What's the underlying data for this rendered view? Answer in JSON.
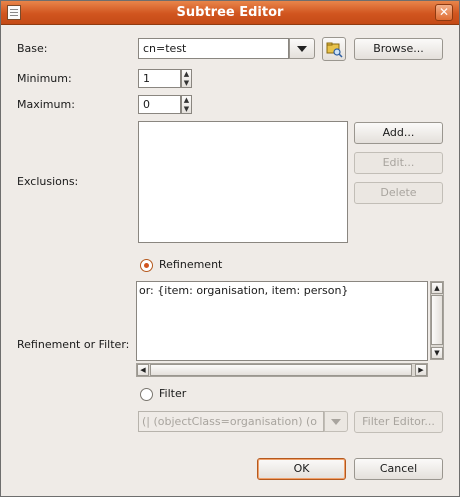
{
  "window": {
    "title": "Subtree Editor",
    "close_glyph": "✕"
  },
  "labels": {
    "base": "Base:",
    "minimum": "Minimum:",
    "maximum": "Maximum:",
    "exclusions": "Exclusions:",
    "refinement_or_filter": "Refinement or Filter:"
  },
  "base": {
    "value": "cn=test",
    "browse_label": "Browse..."
  },
  "minimum": {
    "value": "1"
  },
  "maximum": {
    "value": "0"
  },
  "exclusions": {
    "add_label": "Add...",
    "edit_label": "Edit...",
    "delete_label": "Delete"
  },
  "refinement": {
    "radio_label": "Refinement",
    "selected": true,
    "text": "or: {item: organisation, item: person}"
  },
  "filter": {
    "radio_label": "Filter",
    "selected": false,
    "value": "(| (objectClass=organisation) (o",
    "editor_label": "Filter Editor..."
  },
  "footer": {
    "ok_label": "OK",
    "cancel_label": "Cancel"
  },
  "colors": {
    "titlebar": "#d1551f",
    "accent": "#d1551f",
    "window_bg": "#efebe7"
  }
}
